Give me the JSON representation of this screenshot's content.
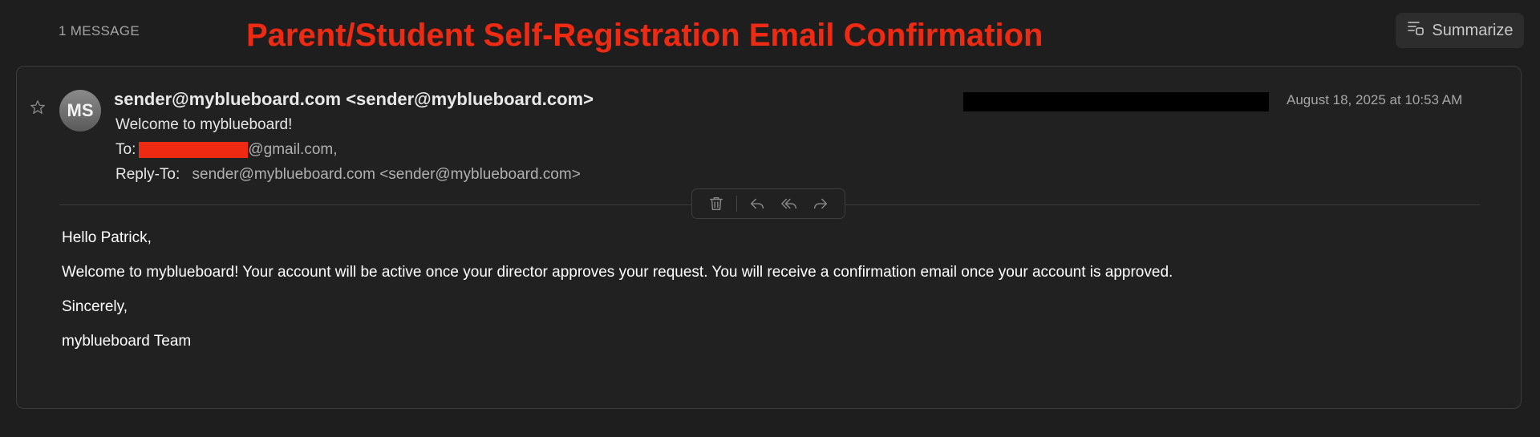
{
  "header": {
    "message_count": "1 MESSAGE",
    "title": "Parent/Student Self-Registration Email Confirmation",
    "summarize_label": "Summarize",
    "summarize_icon": "summarize-icon"
  },
  "email": {
    "avatar_initials": "MS",
    "from": "sender@myblueboard.com <sender@myblueboard.com>",
    "subject": "Welcome to myblueboard!",
    "to_label": "To:",
    "to_value": "@gmail.com,",
    "reply_to_label": "Reply-To:",
    "reply_to_value": "sender@myblueboard.com <sender@myblueboard.com>",
    "date": "August 18, 2025 at 10:53 AM",
    "body": {
      "greeting": "Hello Patrick,",
      "paragraph": "Welcome to myblueboard! Your account will be active once your director approves your request. You will receive a confirmation email once your account is approved.",
      "closing": "Sincerely,",
      "signature": "myblueboard Team"
    }
  },
  "actions": {
    "icons": [
      "trash-icon",
      "reply-icon",
      "reply-all-icon",
      "forward-icon"
    ]
  },
  "colors": {
    "background": "#1e1e1e",
    "card": "#212121",
    "title_red": "#ee2b12",
    "redaction_red": "#ee2b12",
    "redaction_black": "#000000"
  }
}
